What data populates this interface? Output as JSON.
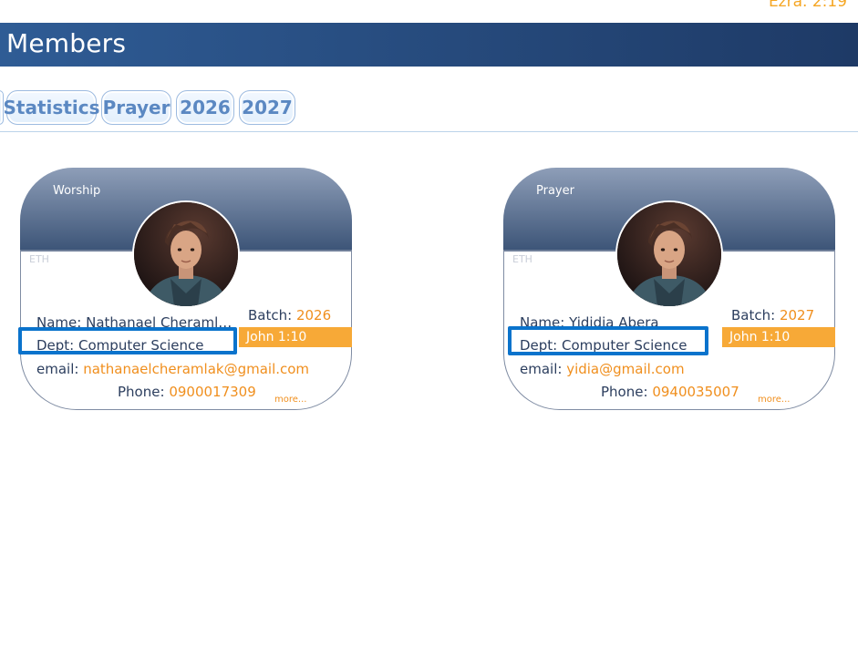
{
  "header": {
    "verse_ref": "Ezra. 2:19",
    "title": "Members"
  },
  "tabs": [
    {
      "label": "Statistics"
    },
    {
      "label": "Prayer"
    },
    {
      "label": "2026"
    },
    {
      "label": "2027"
    }
  ],
  "members": [
    {
      "category": "Worship",
      "country": "ETH",
      "name_label": "Name:",
      "name": "Nathanael Cheramlak",
      "batch_label": "Batch:",
      "batch": "2026",
      "verse": "John 1:10",
      "dept_label": "Dept:",
      "dept": "Computer Science",
      "email_label": "email:",
      "email": "nathanaelcheramlak@gmail.com",
      "phone_label": "Phone:",
      "phone": "0900017309",
      "more": "more..."
    },
    {
      "category": "Prayer",
      "country": "ETH",
      "name_label": "Name:",
      "name": "Yididia Abera",
      "batch_label": "Batch:",
      "batch": "2027",
      "verse": "John 1:10",
      "dept_label": "Dept:",
      "dept": "Computer Science",
      "email_label": "email:",
      "email": "yidia@gmail.com",
      "phone_label": "Phone:",
      "phone": "0940035007",
      "more": "more..."
    }
  ],
  "colors": {
    "accent": "#f08f1e",
    "header_bar": "#1e3a66",
    "highlight": "#0a73cc",
    "verse_band": "#f7a937"
  },
  "icons": {
    "avatar": "member-portrait"
  }
}
